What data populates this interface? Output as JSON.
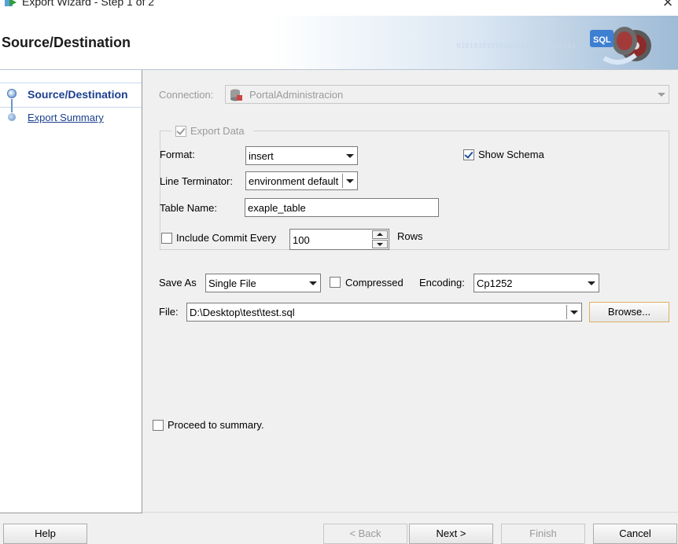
{
  "window": {
    "title": "Export Wizard - Step 1 of 2",
    "close_icon": "close-icon"
  },
  "header": {
    "title": "Source/Destination",
    "binary_text": "0101010101010101010101010101",
    "logo_text": "SQL",
    "logo_icon": "sql-export-icon"
  },
  "nav": {
    "items": [
      {
        "label": "Source/Destination",
        "active": true
      },
      {
        "label": "Export Summary",
        "active": false
      }
    ]
  },
  "connection": {
    "label": "Connection:",
    "value": "PortalAdministracion",
    "icon": "database-icon"
  },
  "export_data": {
    "label": "Export Data",
    "checked": true
  },
  "format": {
    "label": "Format:",
    "value": "insert"
  },
  "show_schema": {
    "label": "Show Schema",
    "checked": true
  },
  "line_terminator": {
    "label": "Line Terminator:",
    "value": "environment default"
  },
  "table_name": {
    "label": "Table Name:",
    "value": "exaple_table"
  },
  "commit": {
    "label": "Include Commit Every",
    "checked": false,
    "value": "100",
    "unit": "Rows"
  },
  "save_as": {
    "label": "Save As",
    "value": "Single File"
  },
  "compressed": {
    "label": "Compressed",
    "checked": false
  },
  "encoding": {
    "label": "Encoding:",
    "value": "Cp1252"
  },
  "file": {
    "label": "File:",
    "value": "D:\\Desktop\\test\\test.sql",
    "browse_label": "Browse..."
  },
  "proceed": {
    "label": "Proceed to summary.",
    "checked": false
  },
  "buttons": {
    "help": "Help",
    "back": "< Back",
    "next": "Next >",
    "finish": "Finish",
    "cancel": "Cancel"
  },
  "colors": {
    "accent": "#1c3f8f",
    "focus_border": "#e0b060"
  }
}
